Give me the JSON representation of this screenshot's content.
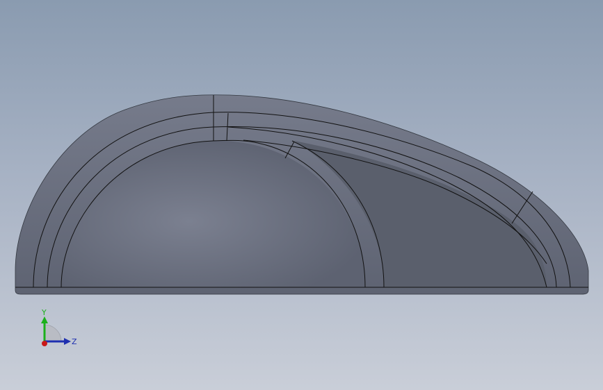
{
  "viewport": {
    "background_top": "#8a9bb0",
    "background_bottom": "#c9ced8"
  },
  "model": {
    "body_color": "#6c7181",
    "recess_color": "#5b606d",
    "edge_color": "#111111"
  },
  "triad": {
    "y_label": "Y",
    "z_label": "Z",
    "y_color": "#1bb01b",
    "z_color": "#1e2fb0",
    "x_color": "#c81818"
  }
}
